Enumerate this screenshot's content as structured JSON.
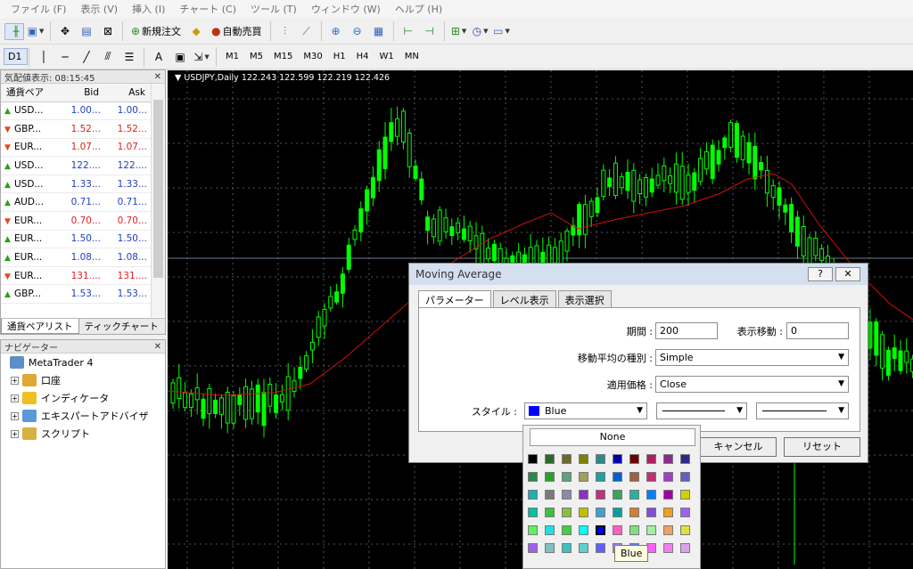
{
  "menu": [
    "ファイル (F)",
    "表示 (V)",
    "挿入 (I)",
    "チャート (C)",
    "ツール (T)",
    "ウィンドウ (W)",
    "ヘルプ (H)"
  ],
  "toolbar1": {
    "new_order_label": "新規注文",
    "auto_trade_label": "自動売買"
  },
  "timeframes": [
    "M1",
    "M5",
    "M15",
    "M30",
    "H1",
    "H4",
    "D1",
    "W1",
    "MN"
  ],
  "selected_timeframe": "D1",
  "market_watch": {
    "title": "気配値表示: 08:15:45",
    "columns": [
      "通貨ペア",
      "Bid",
      "Ask"
    ],
    "rows": [
      {
        "symbol": "USD...",
        "bid": "1.00...",
        "ask": "1.00...",
        "dir": "up"
      },
      {
        "symbol": "GBP...",
        "bid": "1.52...",
        "ask": "1.52...",
        "dir": "down"
      },
      {
        "symbol": "EUR...",
        "bid": "1.07...",
        "ask": "1.07...",
        "dir": "down"
      },
      {
        "symbol": "USD...",
        "bid": "122....",
        "ask": "122....",
        "dir": "up"
      },
      {
        "symbol": "USD...",
        "bid": "1.33...",
        "ask": "1.33...",
        "dir": "up"
      },
      {
        "symbol": "AUD...",
        "bid": "0.71...",
        "ask": "0.71...",
        "dir": "up"
      },
      {
        "symbol": "EUR...",
        "bid": "0.70...",
        "ask": "0.70...",
        "dir": "down"
      },
      {
        "symbol": "EUR...",
        "bid": "1.50...",
        "ask": "1.50...",
        "dir": "up"
      },
      {
        "symbol": "EUR...",
        "bid": "1.08...",
        "ask": "1.08...",
        "dir": "up"
      },
      {
        "symbol": "EUR...",
        "bid": "131....",
        "ask": "131....",
        "dir": "down"
      },
      {
        "symbol": "GBP...",
        "bid": "1.53...",
        "ask": "1.53...",
        "dir": "up"
      }
    ],
    "tabs": [
      "通貨ペアリスト",
      "ティックチャート"
    ]
  },
  "navigator": {
    "title": "ナビゲーター",
    "root": "MetaTrader 4",
    "items": [
      "口座",
      "インディケータ",
      "エキスパートアドバイザ",
      "スクリプト"
    ]
  },
  "chart": {
    "label": "USDJPY,Daily  122.243 122.599 122.219 122.426"
  },
  "dialog": {
    "title": "Moving Average",
    "help": "?",
    "tabs": [
      "パラメーター",
      "レベル表示",
      "表示選択"
    ],
    "period_label": "期間 :",
    "period_value": "200",
    "shift_label": "表示移動 :",
    "shift_value": "0",
    "ma_method_label": "移動平均の種別 :",
    "ma_method_value": "Simple",
    "apply_to_label": "適用価格 :",
    "apply_to_value": "Close",
    "style_label": "スタイル :",
    "style_color": "Blue",
    "cancel_label": "キャンセル",
    "reset_label": "リセット"
  },
  "palette": {
    "none_label": "None",
    "tooltip": "Blue"
  },
  "colors": {
    "candle_up": "#00ff00",
    "candle_bg": "#000000",
    "ma_line": "#d01010",
    "selected_swatch": "#0000ff"
  }
}
